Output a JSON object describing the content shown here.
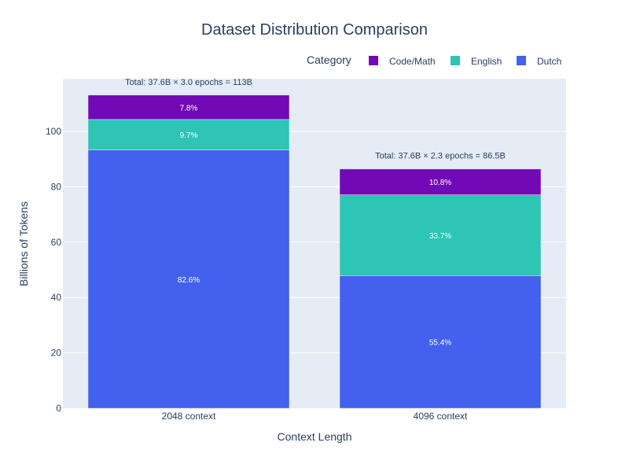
{
  "chart_data": {
    "type": "bar",
    "barmode": "stack",
    "title": "Dataset Distribution Comparison",
    "xlabel": "Context Length",
    "ylabel": "Billions of Tokens",
    "categories": [
      "2048 context",
      "4096 context"
    ],
    "ylim": [
      0,
      115
    ],
    "yticks": [
      0,
      20,
      40,
      60,
      80,
      100
    ],
    "grid": true,
    "legend": {
      "title": "Category",
      "placement": "top-right",
      "orientation": "horizontal",
      "entries": [
        "Code/Math",
        "English",
        "Dutch"
      ]
    },
    "series": [
      {
        "name": "Dutch",
        "color": "#4361ee",
        "values": [
          93.3,
          47.9
        ],
        "labels": [
          "82.6%",
          "55.4%"
        ]
      },
      {
        "name": "English",
        "color": "#2ec4b6",
        "values": [
          11.0,
          29.2
        ],
        "labels": [
          "9.7%",
          "33.7%"
        ]
      },
      {
        "name": "Code/Math",
        "color": "#7209b7",
        "values": [
          8.8,
          9.3
        ],
        "labels": [
          "7.8%",
          "10.8%"
        ]
      }
    ],
    "annotations": [
      {
        "category": "2048 context",
        "text": "Total: 37.6B × 3.0 epochs = 113B",
        "y": 113
      },
      {
        "category": "4096 context",
        "text": "Total: 37.6B × 2.3 epochs = 86.5B",
        "y": 86.5
      }
    ]
  }
}
